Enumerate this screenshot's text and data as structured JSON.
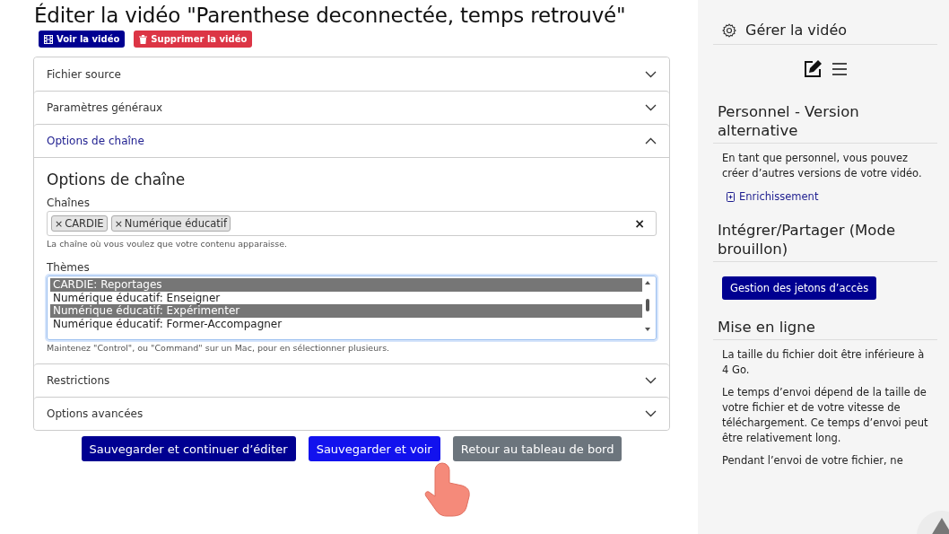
{
  "page_title": "Éditer la vidéo \"Parenthese deconnectée, temps retrouvé\"",
  "actions": [
    {
      "label": "Voir la vidéo",
      "kind": "view"
    },
    {
      "label": "Supprimer la vidéo",
      "kind": "delete"
    }
  ],
  "accordion": [
    {
      "title": "Fichier source",
      "expanded": false
    },
    {
      "title": "Paramètres généraux",
      "expanded": false
    },
    {
      "title": "Options de chaîne",
      "expanded": true
    },
    {
      "title": "Restrictions",
      "expanded": false
    },
    {
      "title": "Options avancées",
      "expanded": false
    }
  ],
  "channel_options": {
    "heading": "Options de chaîne",
    "channels_label": "Chaînes",
    "clear": "×",
    "channels": [
      {
        "remove": "×",
        "label": "CARDIE"
      },
      {
        "remove": "×",
        "label": "Numérique éducatif"
      }
    ],
    "channels_help": "La chaîne où vous voulez que votre contenu apparaisse.",
    "themes_label": "Thèmes",
    "themes": [
      {
        "label": "CARDIE: Reportages",
        "selected": true
      },
      {
        "label": "Numérique éducatif: Enseigner",
        "selected": false
      },
      {
        "label": "Numérique éducatif: Expérimenter",
        "selected": true
      },
      {
        "label": "Numérique éducatif: Former-Accompagner",
        "selected": false
      }
    ],
    "themes_help": "Maintenez \"Control\", ou \"Command\" sur un Mac, pour en sélectionner plusieurs."
  },
  "form_buttons": [
    {
      "label": "Sauvegarder et continuer d’éditer",
      "kind": "primary"
    },
    {
      "label": "Sauvegarder et voir",
      "kind": "accent"
    },
    {
      "label": "Retour au tableau de bord",
      "kind": "secondary"
    }
  ],
  "sidebar": {
    "title": "Gérer la vidéo",
    "sections": [
      {
        "heading": "Personnel - Version alternative",
        "items": [
          {
            "kind": "text",
            "text": "En tant que personnel, vous pouvez créer d’autres versions de votre vidéo."
          },
          {
            "kind": "link",
            "text": "Enrichissement"
          }
        ]
      },
      {
        "heading": "Intégrer/Partager (Mode brouillon)",
        "items": [
          {
            "kind": "button",
            "text": "Gestion des jetons d’accès"
          }
        ]
      },
      {
        "heading": "Mise en ligne",
        "items": [
          {
            "kind": "text",
            "text": "La taille du fichier doit être inférieure à 4 Go."
          },
          {
            "kind": "text",
            "text": "Le temps d’envoi dépend de la taille de votre fichier et de votre vitesse de téléchargement. Ce temps d’envoi peut être relativement long."
          },
          {
            "kind": "text",
            "text": "Pendant l’envoi de votre fichier, ne"
          }
        ]
      }
    ]
  }
}
